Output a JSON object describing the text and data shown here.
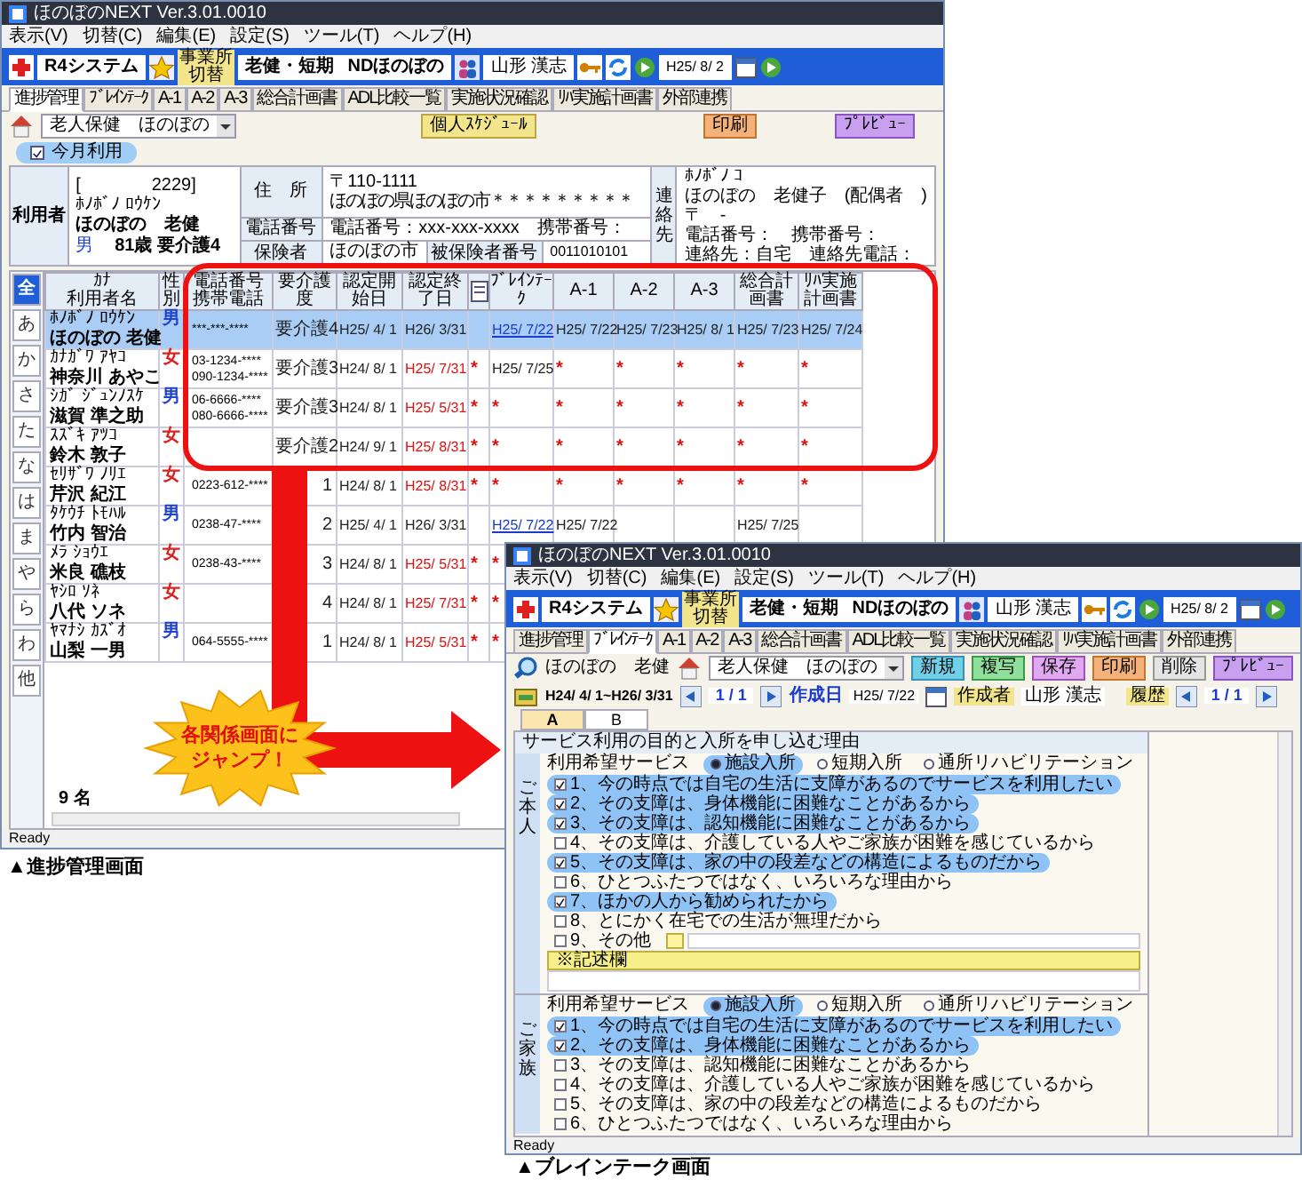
{
  "main_window": {
    "title": "ほのぼのNEXT Ver.3.01.0010",
    "menu": [
      "表示(V)",
      "切替(C)",
      "編集(E)",
      "設定(S)",
      "ツール(T)",
      "ヘルプ(H)"
    ],
    "toolbar": {
      "system": "R4システム",
      "office_switch": "事業所切替",
      "facility": "老健・短期",
      "office": "NDほのぼの",
      "staff": "山形 漢志",
      "date": "H25/ 8/ 2"
    },
    "tabs": [
      {
        "label": "進捗管理",
        "selected": true
      },
      {
        "label": "ﾌﾞﾚｲﾝﾃｰｸ",
        "selected": false
      },
      {
        "label": "A-1",
        "selected": false
      },
      {
        "label": "A-2",
        "selected": false
      },
      {
        "label": "A-3",
        "selected": false
      },
      {
        "label": "総合計画書",
        "selected": false
      },
      {
        "label": "ADL比較一覧",
        "selected": false
      },
      {
        "label": "実施状況確認",
        "selected": false
      },
      {
        "label": "ﾘﾊ実施計画書",
        "selected": false
      },
      {
        "label": "外部連携",
        "selected": false
      }
    ],
    "service_select": "老人保健　ほのぼの",
    "buttons": [
      {
        "label": "個人ｽｹｼﾞｭｰﾙ",
        "kind": "schedule"
      },
      {
        "label": "印刷",
        "kind": "print"
      },
      {
        "label": "ﾌﾟﾚﾋﾞｭｰ",
        "kind": "preview"
      }
    ],
    "filter_chip": {
      "label": "今月利用",
      "checked": true
    },
    "user": {
      "label": "利用者",
      "id": "[　　　　2229]",
      "kana": "ﾎﾉﾎﾞﾉ ﾛｳｹﾝ",
      "name": "ほのぼの　老健",
      "sex": "男",
      "age_care": "81歳 要介護4"
    },
    "address": {
      "label": "住　所",
      "postal": "〒110-1111",
      "line": "ほのぼの県ほのぼの市＊＊＊＊＊＊＊＊＊"
    },
    "phone": {
      "label": "電話番号",
      "value": "電話番号：xxx-xxx-xxxx　携帯番号："
    },
    "insurer": {
      "label": "保険者",
      "value": "ほのぼの市",
      "number_label": "被保険者番号",
      "number": "0011010101"
    },
    "contact": {
      "label": "連絡先",
      "lines": [
        "ﾎﾉﾎﾞﾉ ｺ",
        "ほのぼの　老健子　(配偶者　)",
        "〒　-",
        "電話番号：　携帯番号：",
        "連絡先：自宅　連絡先電話："
      ]
    },
    "index_tabs": [
      {
        "label": "全",
        "selected": true
      },
      {
        "label": "あ",
        "selected": false
      },
      {
        "label": "か",
        "selected": false
      },
      {
        "label": "さ",
        "selected": false
      },
      {
        "label": "た",
        "selected": false
      },
      {
        "label": "な",
        "selected": false
      },
      {
        "label": "は",
        "selected": false
      },
      {
        "label": "ま",
        "selected": false
      },
      {
        "label": "や",
        "selected": false
      },
      {
        "label": "ら",
        "selected": false
      },
      {
        "label": "わ",
        "selected": false
      },
      {
        "label": "他",
        "selected": false
      }
    ],
    "table": {
      "lead_columns": [
        {
          "lines": [
            "ｶﾅ",
            "利用者名"
          ]
        },
        {
          "lines": [
            "性別"
          ]
        },
        {
          "lines": [
            "電話番号",
            "携帯電話"
          ]
        }
      ],
      "columns": [
        {
          "lines": [
            "要介護度"
          ]
        },
        {
          "lines": [
            "認定開始日"
          ]
        },
        {
          "lines": [
            "認定終了日"
          ]
        },
        {
          "kind": "icon"
        },
        {
          "lines": [
            "ﾌﾞﾚｲﾝﾃｰｸ"
          ]
        },
        {
          "lines": [
            "A-1"
          ]
        },
        {
          "lines": [
            "A-2"
          ]
        },
        {
          "lines": [
            "A-3"
          ]
        },
        {
          "lines": [
            "総合計画書"
          ]
        },
        {
          "lines": [
            "ﾘﾊ実施計画書"
          ]
        }
      ],
      "rows": [
        {
          "kana": "ﾎﾉﾎﾞﾉ ﾛｳｹﾝ",
          "name": "ほのぼの 老健",
          "sex": "男",
          "color": "#2244cc",
          "phones": [
            "***-***-****"
          ],
          "selected": true,
          "cells": [
            {
              "text": "要介護4",
              "kind": "plain"
            },
            {
              "text": "H25/ 4/ 1",
              "kind": "plain"
            },
            {
              "text": "H26/ 3/31",
              "kind": "plain"
            },
            {
              "kind": "blank"
            },
            {
              "text": "H25/ 7/22",
              "kind": "link"
            },
            {
              "text": "H25/ 7/22",
              "kind": "plain"
            },
            {
              "text": "H25/ 7/23",
              "kind": "plain"
            },
            {
              "text": "H25/ 8/ 1",
              "kind": "plain"
            },
            {
              "text": "H25/ 7/23",
              "kind": "plain"
            },
            {
              "text": "H25/ 7/24",
              "kind": "plain"
            }
          ]
        },
        {
          "kana": "ｶﾅｶﾞﾜ ｱﾔｺ",
          "name": "神奈川 あやこ",
          "sex": "女",
          "color": "#dd2222",
          "phones": [
            "03-1234-****",
            "090-1234-****"
          ],
          "selected": false,
          "cells": [
            {
              "text": "要介護3",
              "kind": "plain"
            },
            {
              "text": "H24/ 8/ 1",
              "kind": "plain"
            },
            {
              "text": "H25/ 7/31",
              "kind": "alert"
            },
            {
              "text": "*",
              "kind": "mark"
            },
            {
              "text": "H25/ 7/25",
              "kind": "plain"
            },
            {
              "text": "*",
              "kind": "mark"
            },
            {
              "text": "*",
              "kind": "mark"
            },
            {
              "text": "*",
              "kind": "mark"
            },
            {
              "text": "*",
              "kind": "mark"
            },
            {
              "text": "*",
              "kind": "mark"
            }
          ]
        },
        {
          "kana": "ｼｶﾞ ｼﾞｭﾝﾉｽｹ",
          "name": "滋賀 準之助",
          "sex": "男",
          "color": "#2244cc",
          "phones": [
            "06-6666-****",
            "080-6666-****"
          ],
          "selected": false,
          "cells": [
            {
              "text": "要介護3",
              "kind": "plain"
            },
            {
              "text": "H24/ 8/ 1",
              "kind": "plain"
            },
            {
              "text": "H25/ 5/31",
              "kind": "alert"
            },
            {
              "text": "*",
              "kind": "mark"
            },
            {
              "text": "*",
              "kind": "mark"
            },
            {
              "text": "*",
              "kind": "mark"
            },
            {
              "text": "*",
              "kind": "mark"
            },
            {
              "text": "*",
              "kind": "mark"
            },
            {
              "text": "*",
              "kind": "mark"
            },
            {
              "text": "*",
              "kind": "mark"
            }
          ]
        },
        {
          "kana": "ｽｽﾞｷ ｱﾂｺ",
          "name": "鈴木 敦子",
          "sex": "女",
          "color": "#dd2222",
          "phones": [],
          "selected": false,
          "cells": [
            {
              "text": "要介護2",
              "kind": "plain"
            },
            {
              "text": "H24/ 9/ 1",
              "kind": "plain"
            },
            {
              "text": "H25/ 8/31",
              "kind": "alert"
            },
            {
              "text": "*",
              "kind": "mark"
            },
            {
              "text": "*",
              "kind": "mark"
            },
            {
              "text": "*",
              "kind": "mark"
            },
            {
              "text": "*",
              "kind": "mark"
            },
            {
              "text": "*",
              "kind": "mark"
            },
            {
              "text": "*",
              "kind": "mark"
            },
            {
              "text": "*",
              "kind": "mark"
            }
          ]
        },
        {
          "kana": "ｾﾘｻﾞﾜ ﾉﾘｴ",
          "name": "芹沢 紀江",
          "sex": "女",
          "color": "#dd2222",
          "phones": [
            "0223-612-****"
          ],
          "selected": false,
          "cells": [
            {
              "text": "1",
              "kind": "plain"
            },
            {
              "text": "H24/ 8/ 1",
              "kind": "plain"
            },
            {
              "text": "H25/ 8/31",
              "kind": "alert"
            },
            {
              "text": "*",
              "kind": "mark"
            },
            {
              "text": "*",
              "kind": "mark"
            },
            {
              "text": "*",
              "kind": "mark"
            },
            {
              "text": "*",
              "kind": "mark"
            },
            {
              "text": "*",
              "kind": "mark"
            },
            {
              "text": "*",
              "kind": "mark"
            },
            {
              "text": "*",
              "kind": "mark"
            }
          ]
        },
        {
          "kana": "ﾀｹｳﾁ ﾄﾓﾊﾙ",
          "name": "竹内 智治",
          "sex": "男",
          "color": "#2244cc",
          "phones": [
            "0238-47-****"
          ],
          "selected": false,
          "cells": [
            {
              "text": "2",
              "kind": "plain"
            },
            {
              "text": "H25/ 4/ 1",
              "kind": "plain"
            },
            {
              "text": "H26/ 3/31",
              "kind": "plain"
            },
            {
              "kind": "blank"
            },
            {
              "text": "H25/ 7/22",
              "kind": "link"
            },
            {
              "text": "H25/ 7/22",
              "kind": "plain"
            },
            {
              "kind": "blank"
            },
            {
              "kind": "blank"
            },
            {
              "text": "H25/ 7/25",
              "kind": "plain"
            }
          ]
        },
        {
          "kana": "ﾒﾗ ｼｮｳｴ",
          "name": "米良 礁枝",
          "sex": "女",
          "color": "#dd2222",
          "phones": [
            "0238-43-****"
          ],
          "selected": false,
          "cells": [
            {
              "text": "3",
              "kind": "plain"
            },
            {
              "text": "H24/ 8/ 1",
              "kind": "plain"
            },
            {
              "text": "H25/ 5/31",
              "kind": "alert"
            },
            {
              "text": "*",
              "kind": "mark"
            },
            {
              "text": "*",
              "kind": "mark"
            }
          ]
        },
        {
          "kana": "ﾔｼﾛ ｿﾈ",
          "name": "八代 ソネ",
          "sex": "女",
          "color": "#dd2222",
          "phones": [],
          "selected": false,
          "cells": [
            {
              "text": "4",
              "kind": "plain"
            },
            {
              "text": "H24/ 8/ 1",
              "kind": "plain"
            },
            {
              "text": "H25/ 7/31",
              "kind": "alert"
            },
            {
              "text": "*",
              "kind": "mark"
            },
            {
              "text": "*",
              "kind": "mark"
            }
          ]
        },
        {
          "kana": "ﾔﾏﾅｼ ｶｽﾞｵ",
          "name": "山梨 一男",
          "sex": "男",
          "color": "#2244cc",
          "phones": [
            "064-5555-****"
          ],
          "selected": false,
          "cells": [
            {
              "text": "1",
              "kind": "plain"
            },
            {
              "text": "H24/ 8/ 1",
              "kind": "plain"
            },
            {
              "text": "H25/ 5/31",
              "kind": "alert"
            },
            {
              "text": "*",
              "kind": "mark"
            },
            {
              "text": "*",
              "kind": "mark"
            }
          ]
        }
      ]
    },
    "count": "9 名",
    "status": "Ready"
  },
  "callout": [
    "各関係画面に",
    "ジャンプ！"
  ],
  "captions": [
    "▲進捗管理画面",
    "▲ブレインテーク画面"
  ],
  "detail_window": {
    "title": "ほのぼのNEXT Ver.3.01.0010",
    "menu": [
      "表示(V)",
      "切替(C)",
      "編集(E)",
      "設定(S)",
      "ツール(T)",
      "ヘルプ(H)"
    ],
    "toolbar": {
      "system": "R4システム",
      "office_switch": "事業所切替",
      "facility": "老健・短期",
      "office": "NDほのぼの",
      "staff": "山形 漢志",
      "date": "H25/ 8/ 2"
    },
    "tabs": [
      {
        "label": "進捗管理",
        "selected": false
      },
      {
        "label": "ﾌﾞﾚｲﾝﾃｰｸ",
        "selected": true
      },
      {
        "label": "A-1",
        "selected": false
      },
      {
        "label": "A-2",
        "selected": false
      },
      {
        "label": "A-3",
        "selected": false
      },
      {
        "label": "総合計画書",
        "selected": false
      },
      {
        "label": "ADL比較一覧",
        "selected": false
      },
      {
        "label": "実施状況確認",
        "selected": false
      },
      {
        "label": "ﾘﾊ実施計画書",
        "selected": false
      },
      {
        "label": "外部連携",
        "selected": false
      }
    ],
    "user_name": "ほのぼの　老健",
    "service_select": "老人保健　ほのぼの",
    "buttons": [
      {
        "label": "新規",
        "kind": "new"
      },
      {
        "label": "複写",
        "kind": "copy"
      },
      {
        "label": "保存",
        "kind": "save"
      },
      {
        "label": "印刷",
        "kind": "print"
      },
      {
        "label": "削除",
        "kind": "delete"
      },
      {
        "label": "ﾌﾟﾚﾋﾞｭｰ",
        "kind": "preview"
      }
    ],
    "period": "H24/ 4/ 1~H26/ 3/31",
    "page": "1 / 1",
    "created_label": "作成日",
    "created": "H25/ 7/22",
    "author_label": "作成者",
    "author": "山形 漢志",
    "history_label": "履歴",
    "history_page": "1 / 1",
    "form_tabs": [
      {
        "label": "A",
        "selected": true
      },
      {
        "label": "B",
        "selected": false
      }
    ],
    "section_title": "サービス利用の目的と入所を申し込む理由",
    "blocks": [
      {
        "side_label": "ご本人",
        "service_label": "利用希望サービス",
        "services": [
          {
            "label": "施設入所",
            "selected": true
          },
          {
            "label": "短期入所",
            "selected": false
          },
          {
            "label": "通所リハビリテーション",
            "selected": false
          }
        ],
        "reasons": [
          {
            "label": "1、今の時点では自宅の生活に支障があるのでサービスを利用したい",
            "checked": true,
            "kind": "check"
          },
          {
            "label": "2、その支障は、身体機能に困難なことがあるから",
            "checked": true,
            "kind": "check"
          },
          {
            "label": "3、その支障は、認知機能に困難なことがあるから",
            "checked": true,
            "kind": "check"
          },
          {
            "label": "4、その支障は、介護している人やご家族が困難を感じているから",
            "checked": false,
            "kind": "check"
          },
          {
            "label": "5、その支障は、家の中の段差などの構造によるものだから",
            "checked": true,
            "kind": "check"
          },
          {
            "label": "6、ひとつふたつではなく、いろいろな理由から",
            "checked": false,
            "kind": "check"
          },
          {
            "label": "7、ほかの人から勧められたから",
            "checked": true,
            "kind": "check"
          },
          {
            "label": "8、とにかく在宅での生活が無理だから",
            "checked": false,
            "kind": "check"
          },
          {
            "label": "9、その他",
            "checked": false,
            "kind": "other"
          }
        ],
        "memo_label": "※記述欄"
      },
      {
        "side_label": "ご家族",
        "service_label": "利用希望サービス",
        "services": [
          {
            "label": "施設入所",
            "selected": true
          },
          {
            "label": "短期入所",
            "selected": false
          },
          {
            "label": "通所リハビリテーション",
            "selected": false
          }
        ],
        "reasons": [
          {
            "label": "1、今の時点では自宅の生活に支障があるのでサービスを利用したい",
            "checked": true,
            "kind": "check"
          },
          {
            "label": "2、その支障は、身体機能に困難なことがあるから",
            "checked": true,
            "kind": "check"
          },
          {
            "label": "3、その支障は、認知機能に困難なことがあるから",
            "checked": false,
            "kind": "check"
          },
          {
            "label": "4、その支障は、介護している人やご家族が困難を感じているから",
            "checked": false,
            "kind": "check"
          },
          {
            "label": "5、その支障は、家の中の段差などの構造によるものだから",
            "checked": false,
            "kind": "check"
          },
          {
            "label": "6、ひとつふたつではなく、いろいろな理由から",
            "checked": false,
            "kind": "check"
          }
        ]
      }
    ],
    "status": "Ready"
  }
}
